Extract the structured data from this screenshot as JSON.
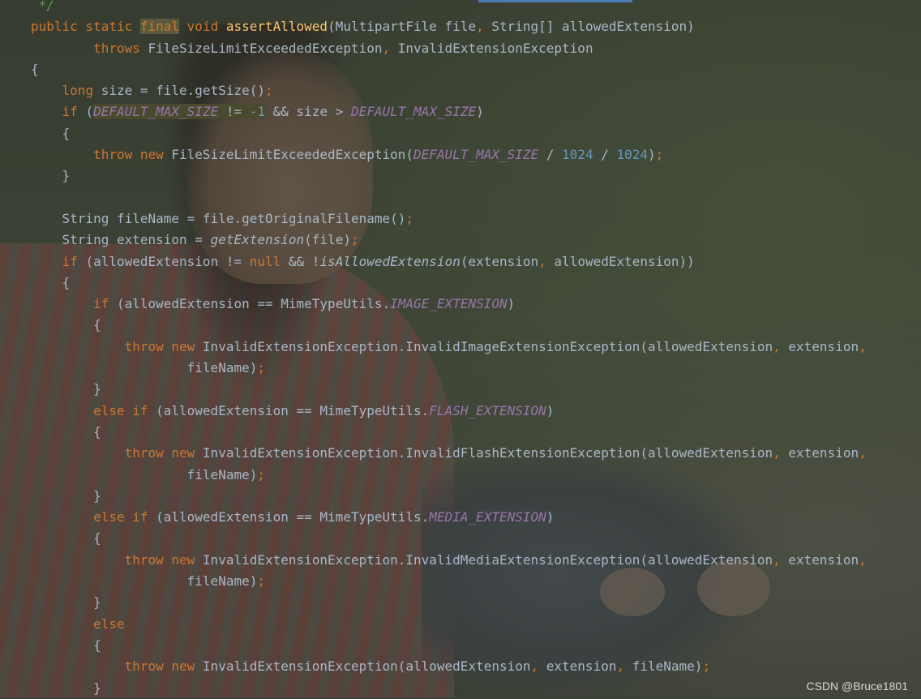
{
  "editor": {
    "lines": [
      [
        {
          "t": " */",
          "c": "cm"
        }
      ],
      [
        {
          "t": "public static ",
          "c": "kw"
        },
        {
          "t": "final",
          "c": "kw hlk"
        },
        {
          "t": " void ",
          "c": "kw"
        },
        {
          "t": "assertAllowed",
          "c": "fn"
        },
        {
          "t": "(MultipartFile file",
          "c": ""
        },
        {
          "t": ", ",
          "c": "kw"
        },
        {
          "t": "String[] allowedExtension)",
          "c": ""
        }
      ],
      [
        {
          "t": "        throws ",
          "c": "kw"
        },
        {
          "t": "FileSizeLimitExceededException",
          "c": ""
        },
        {
          "t": ", ",
          "c": "kw"
        },
        {
          "t": "InvalidExtensionException",
          "c": ""
        }
      ],
      [
        {
          "t": "{",
          "c": ""
        }
      ],
      [
        {
          "t": "    long ",
          "c": "kw"
        },
        {
          "t": "size = file.getSize()",
          "c": ""
        },
        {
          "t": ";",
          "c": "kw"
        }
      ],
      [
        {
          "t": "    if ",
          "c": "kw"
        },
        {
          "t": "(",
          "c": ""
        },
        {
          "t": "DEFAULT_MAX_SIZE != -1",
          "c": "hl mix"
        },
        {
          "t": " && size > ",
          "c": ""
        },
        {
          "t": "DEFAULT_MAX_SIZE",
          "c": "cn"
        },
        {
          "t": ")",
          "c": ""
        }
      ],
      [
        {
          "t": "    {",
          "c": ""
        }
      ],
      [
        {
          "t": "        throw new ",
          "c": "kw"
        },
        {
          "t": "FileSizeLimitExceededException(",
          "c": ""
        },
        {
          "t": "DEFAULT_MAX_SIZE",
          "c": "cn"
        },
        {
          "t": " / ",
          "c": ""
        },
        {
          "t": "1024",
          "c": "num"
        },
        {
          "t": " / ",
          "c": ""
        },
        {
          "t": "1024",
          "c": "num"
        },
        {
          "t": ")",
          "c": ""
        },
        {
          "t": ";",
          "c": "kw"
        }
      ],
      [
        {
          "t": "    }",
          "c": ""
        }
      ],
      [
        {
          "t": "",
          "c": ""
        }
      ],
      [
        {
          "t": "    String fileName = file.getOriginalFilename()",
          "c": ""
        },
        {
          "t": ";",
          "c": "kw"
        }
      ],
      [
        {
          "t": "    String extension = ",
          "c": ""
        },
        {
          "t": "getExtension",
          "c": "it"
        },
        {
          "t": "(file)",
          "c": ""
        },
        {
          "t": ";",
          "c": "kw"
        }
      ],
      [
        {
          "t": "    if ",
          "c": "kw"
        },
        {
          "t": "(allowedExtension != ",
          "c": ""
        },
        {
          "t": "null",
          "c": "kw"
        },
        {
          "t": " && !",
          "c": ""
        },
        {
          "t": "isAllowedExtension",
          "c": "it"
        },
        {
          "t": "(extension",
          "c": ""
        },
        {
          "t": ", ",
          "c": "kw"
        },
        {
          "t": "allowedExtension))",
          "c": ""
        }
      ],
      [
        {
          "t": "    {",
          "c": ""
        }
      ],
      [
        {
          "t": "        if ",
          "c": "kw"
        },
        {
          "t": "(allowedExtension == MimeTypeUtils.",
          "c": ""
        },
        {
          "t": "IMAGE_EXTENSION",
          "c": "cn"
        },
        {
          "t": ")",
          "c": ""
        }
      ],
      [
        {
          "t": "        {",
          "c": ""
        }
      ],
      [
        {
          "t": "            throw new ",
          "c": "kw"
        },
        {
          "t": "InvalidExtensionException.InvalidImageExtensionException(allowedExtension",
          "c": ""
        },
        {
          "t": ", ",
          "c": "kw"
        },
        {
          "t": "extension",
          "c": ""
        },
        {
          "t": ",",
          "c": "kw"
        }
      ],
      [
        {
          "t": "                    fileName)",
          "c": ""
        },
        {
          "t": ";",
          "c": "kw"
        }
      ],
      [
        {
          "t": "        }",
          "c": ""
        }
      ],
      [
        {
          "t": "        else if ",
          "c": "kw"
        },
        {
          "t": "(allowedExtension == MimeTypeUtils.",
          "c": ""
        },
        {
          "t": "FLASH_EXTENSION",
          "c": "cn"
        },
        {
          "t": ")",
          "c": ""
        }
      ],
      [
        {
          "t": "        {",
          "c": ""
        }
      ],
      [
        {
          "t": "            throw new ",
          "c": "kw"
        },
        {
          "t": "InvalidExtensionException.InvalidFlashExtensionException(allowedExtension",
          "c": ""
        },
        {
          "t": ", ",
          "c": "kw"
        },
        {
          "t": "extension",
          "c": ""
        },
        {
          "t": ",",
          "c": "kw"
        }
      ],
      [
        {
          "t": "                    fileName)",
          "c": ""
        },
        {
          "t": ";",
          "c": "kw"
        }
      ],
      [
        {
          "t": "        }",
          "c": ""
        }
      ],
      [
        {
          "t": "        else if ",
          "c": "kw"
        },
        {
          "t": "(allowedExtension == MimeTypeUtils.",
          "c": ""
        },
        {
          "t": "MEDIA_EXTENSION",
          "c": "cn"
        },
        {
          "t": ")",
          "c": ""
        }
      ],
      [
        {
          "t": "        {",
          "c": ""
        }
      ],
      [
        {
          "t": "            throw new ",
          "c": "kw"
        },
        {
          "t": "InvalidExtensionException.InvalidMediaExtensionException(allowedExtension",
          "c": ""
        },
        {
          "t": ", ",
          "c": "kw"
        },
        {
          "t": "extension",
          "c": ""
        },
        {
          "t": ",",
          "c": "kw"
        }
      ],
      [
        {
          "t": "                    fileName)",
          "c": ""
        },
        {
          "t": ";",
          "c": "kw"
        }
      ],
      [
        {
          "t": "        }",
          "c": ""
        }
      ],
      [
        {
          "t": "        else",
          "c": "kw"
        }
      ],
      [
        {
          "t": "        {",
          "c": ""
        }
      ],
      [
        {
          "t": "            throw new ",
          "c": "kw"
        },
        {
          "t": "InvalidExtensionException(allowedExtension",
          "c": ""
        },
        {
          "t": ", ",
          "c": "kw"
        },
        {
          "t": "extension",
          "c": ""
        },
        {
          "t": ", ",
          "c": "kw"
        },
        {
          "t": "fileName)",
          "c": ""
        },
        {
          "t": ";",
          "c": "kw"
        }
      ],
      [
        {
          "t": "        }",
          "c": ""
        }
      ]
    ]
  },
  "watermark": "CSDN @Bruce1801",
  "colors": {
    "keyword": "#cc7832",
    "method_declaration": "#ffc66d",
    "constant": "#9876aa",
    "number": "#6897bb",
    "default_text": "#a9b7c6",
    "comment": "#629755"
  }
}
